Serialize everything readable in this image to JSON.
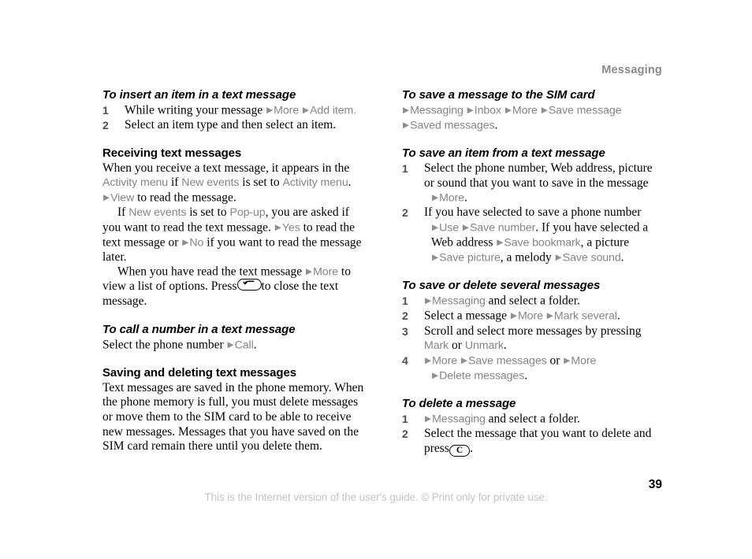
{
  "running_head": "Messaging",
  "page_number": "39",
  "footer_note": "This is the Internet version of the user's guide. © Print only for private use.",
  "arrow_glyph": "▶",
  "colors": {
    "ui_term": "#858585",
    "running_head": "#8a8a8a",
    "footer_note": "#c3c3c3",
    "step_number": "#4d4d4d",
    "body_text": "#000000"
  },
  "left_column": {
    "h_insert_item": "To insert an item in a text message",
    "insert_steps": {
      "s1_num": "1",
      "s1_a": "While writing your message",
      "s1_ui_more": "More",
      "s1_ui_additem": "Add item",
      "s1_end": ".",
      "s2_num": "2",
      "s2_text": "Select an item type and then select an item."
    },
    "h_receiving": "Receiving text messages",
    "recv_p1_a": "When you receive a text message, it appears in the",
    "recv_p1_ui_activity1": "Activity menu",
    "recv_p1_b": "if",
    "recv_p1_ui_newevents": "New events",
    "recv_p1_c": "is set to",
    "recv_p1_ui_activity2": "Activity menu",
    "recv_p1_d": ".",
    "recv_p2_ui_view": "View",
    "recv_p2_a": "to read the message.",
    "recv_p3_a": "If",
    "recv_p3_ui_newevents": "New events",
    "recv_p3_b": "is set to",
    "recv_p3_ui_popup": "Pop-up",
    "recv_p3_c": ", you are asked if you want to read the text message.",
    "recv_p3_ui_yes": "Yes",
    "recv_p3_d": "to read the text message or",
    "recv_p3_ui_no": "No",
    "recv_p3_e": "if you want to read the message later.",
    "recv_p4_a": "When you have read the text message",
    "recv_p4_ui_more": "More",
    "recv_p4_b": "to view a list of options. Press",
    "recv_p4_key": "back-key",
    "recv_p4_c": "to close the text message.",
    "h_call_number": "To call a number in a text message",
    "call_p_a": "Select the phone number",
    "call_p_ui_call": "Call",
    "call_p_b": ".",
    "h_saving_deleting": "Saving and deleting text messages",
    "saving_p": "Text messages are saved in the phone memory. When the phone memory is full, you must delete messages or move them to the SIM card to be able to receive new messages. Messages that you have saved on the SIM card remain there until you delete them."
  },
  "right_column": {
    "h_save_sim": "To save a message to the SIM card",
    "save_sim_ui_messaging": "Messaging",
    "save_sim_ui_inbox": "Inbox",
    "save_sim_ui_more": "More",
    "save_sim_ui_savemessage": "Save message",
    "save_sim_ui_savedmessages": "Saved messages",
    "save_sim_end": ".",
    "h_save_item": "To save an item from a text message",
    "save_item_s1_num": "1",
    "save_item_s1_text": "Select the phone number, Web address, picture or sound that you want to save in the message",
    "save_item_s1_ui_more": "More",
    "save_item_s1_end": ".",
    "save_item_s2_num": "2",
    "save_item_s2_a": "If you have selected to save a phone number",
    "save_item_s2_ui_use": "Use",
    "save_item_s2_ui_savenumber": "Save number",
    "save_item_s2_b": ". If you have selected a Web address",
    "save_item_s2_ui_savebookmark": "Save bookmark",
    "save_item_s2_c": ", a picture",
    "save_item_s2_ui_savepicture": "Save picture",
    "save_item_s2_d": ", a melody",
    "save_item_s2_ui_savesound": "Save sound",
    "save_item_s2_e": ".",
    "h_save_delete_several": "To save or delete several messages",
    "several_s1_num": "1",
    "several_s1_ui_messaging": "Messaging",
    "several_s1_text": "and select a folder.",
    "several_s2_num": "2",
    "several_s2_a": "Select a message",
    "several_s2_ui_more": "More",
    "several_s2_ui_markseveral": "Mark several",
    "several_s2_b": ".",
    "several_s3_num": "3",
    "several_s3_a": "Scroll and select more messages by pressing",
    "several_s3_ui_mark": "Mark",
    "several_s3_b": "or",
    "several_s3_ui_unmark": "Unmark",
    "several_s3_c": ".",
    "several_s4_num": "4",
    "several_s4_ui_more1": "More",
    "several_s4_ui_savemessages": "Save messages",
    "several_s4_a": "or",
    "several_s4_ui_more2": "More",
    "several_s4_ui_deletemessages": "Delete messages",
    "several_s4_b": ".",
    "h_delete_message": "To delete a message",
    "delete_s1_num": "1",
    "delete_s1_ui_messaging": "Messaging",
    "delete_s1_text": "and select a folder.",
    "delete_s2_num": "2",
    "delete_s2_a": "Select the message that you want to delete and press",
    "delete_s2_key": "c-key",
    "delete_s2_b": "."
  }
}
